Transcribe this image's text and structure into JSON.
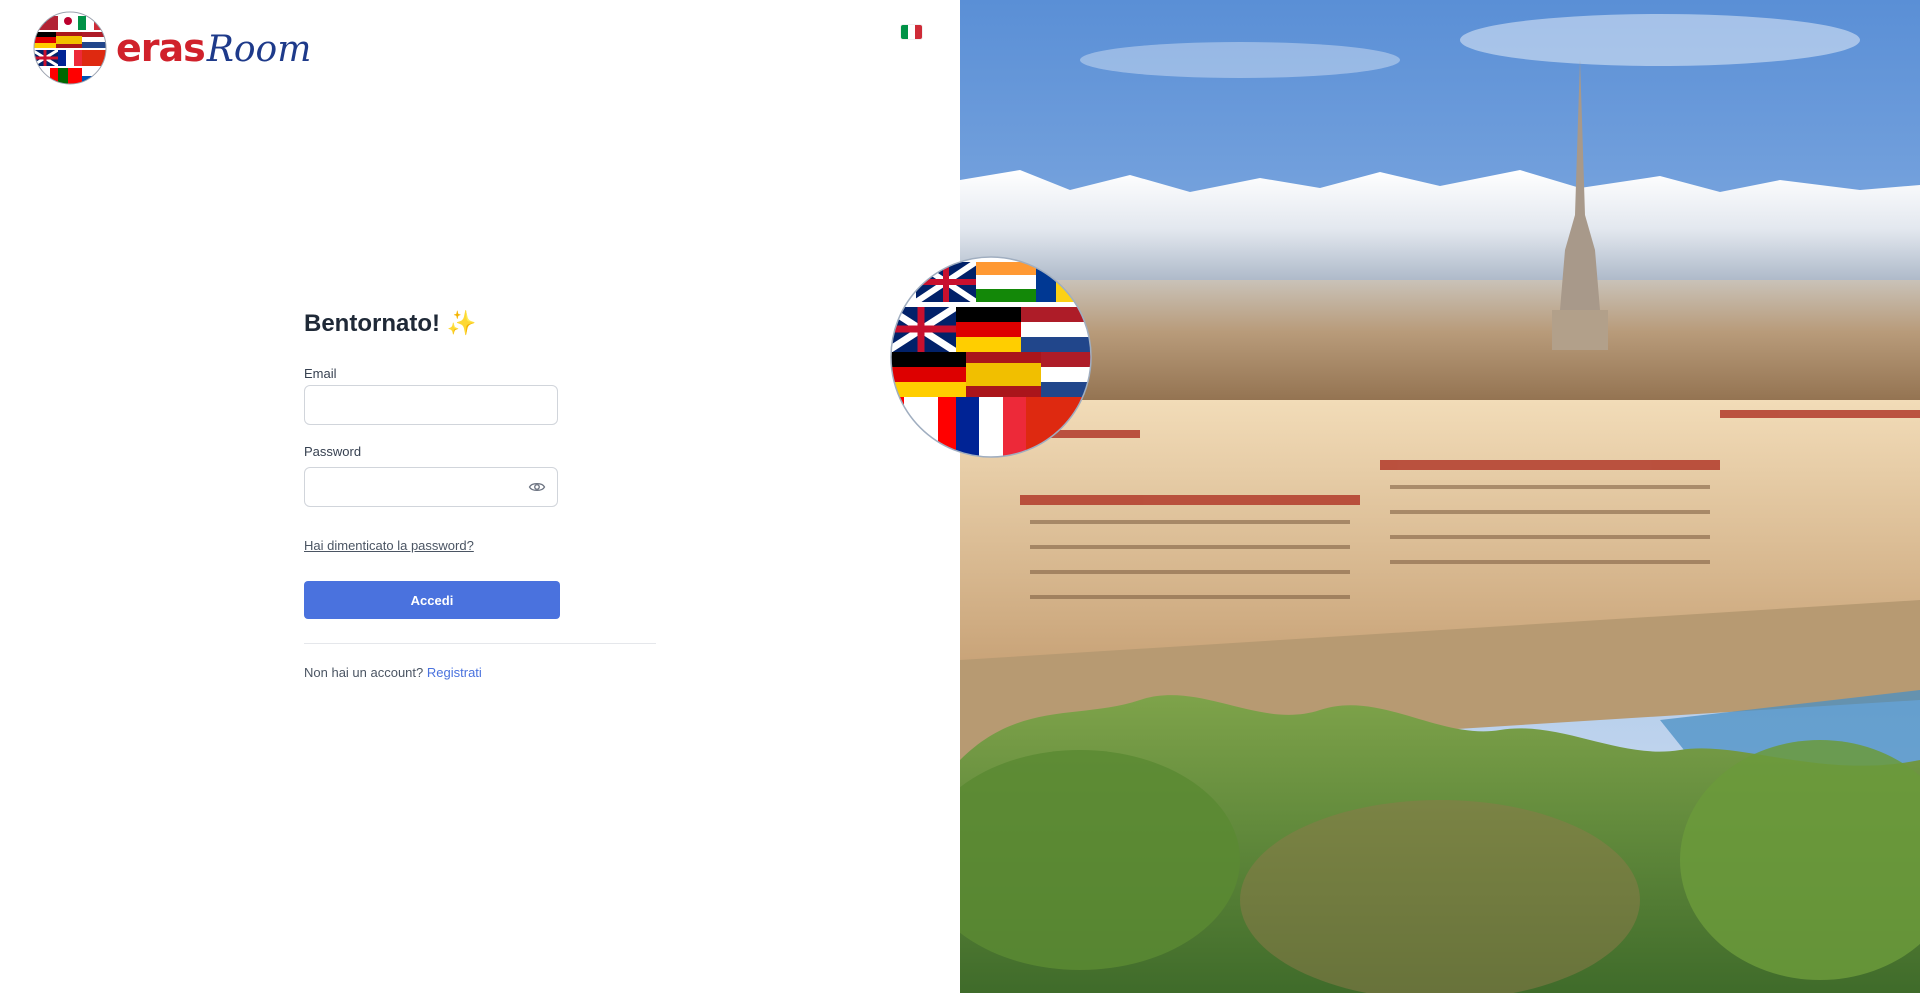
{
  "brand": {
    "name_part1": "eras",
    "name_part2": "Room",
    "globe_icon": "flags-globe-icon",
    "colors": {
      "red": "#d0212b",
      "navy": "#1e3a8a"
    }
  },
  "language_selector": {
    "icon": "italy-flag-icon",
    "colors": [
      "#009246",
      "#ffffff",
      "#ce2b37"
    ]
  },
  "login": {
    "heading": "Bentornato! ✨",
    "email_label": "Email",
    "email_value": "",
    "password_label": "Password",
    "password_value": "",
    "password_toggle_icon": "eye-icon",
    "forgot_link": "Hai dimenticato la password?",
    "submit_label": "Accedi",
    "signup_prompt": "Non hai un account?",
    "signup_link": "Registrati"
  },
  "theme": {
    "accent": "#4a72de",
    "text": "#1f2937",
    "muted": "#4b5563",
    "border": "#d1d5db"
  },
  "hero": {
    "icon": "turin-cityscape-photo"
  }
}
